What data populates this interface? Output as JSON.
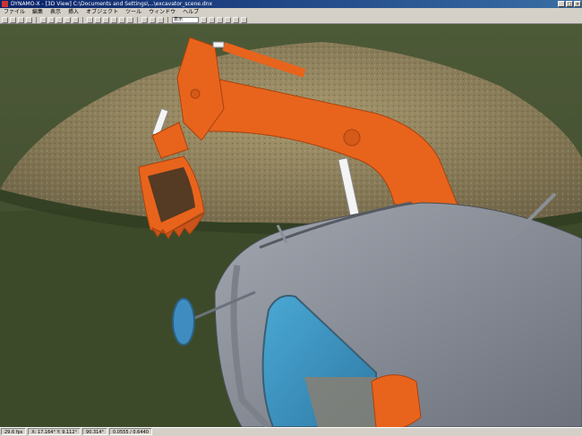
{
  "window": {
    "title": "DYNAMO-X - [3D View] C:\\Documents and Settings\\...\\excavator_scene.dnx"
  },
  "menu": {
    "items": [
      "ファイル",
      "編集",
      "表示",
      "挿入",
      "オブジェクト",
      "ツール",
      "ウィンドウ",
      "ヘルプ"
    ]
  },
  "toolbar": {
    "zoom_value": "表示"
  },
  "status": {
    "fps": "29.6 fps",
    "position": "X: 17.164°  Y: 9.112°",
    "angle": "90.314°",
    "scene": "0.0555 / 0.6440"
  },
  "colors": {
    "excavator": "#e8641c",
    "cab": "#8a8f98",
    "glass": "#4aa0c8",
    "sky": "#5a5446",
    "ground": "#3e4a2c",
    "pile": "#8b7d5a"
  },
  "icons": {
    "toolbar": [
      "new-icon",
      "open-icon",
      "save-icon",
      "print-icon",
      "cut-icon",
      "copy-icon",
      "paste-icon",
      "undo-icon",
      "redo-icon",
      "select-icon",
      "move-icon",
      "rotate-icon",
      "scale-icon",
      "camera-icon",
      "light-icon",
      "render-icon",
      "play-icon",
      "stop-icon",
      "zoom-in-icon",
      "zoom-out-icon",
      "pan-icon",
      "orbit-icon",
      "grid-icon",
      "help-icon"
    ]
  }
}
